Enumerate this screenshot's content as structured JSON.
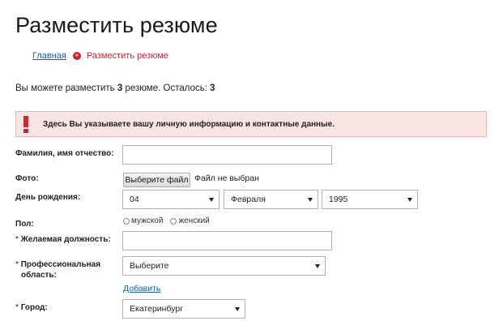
{
  "page": {
    "title": "Разместить резюме"
  },
  "breadcrumb": {
    "home": "Главная",
    "separator": "»",
    "current": "Разместить резюме"
  },
  "quota": {
    "prefix": "Вы можете разместить",
    "count": "3",
    "middle": "резюме. Осталось:",
    "remaining": "3"
  },
  "alert": {
    "icon": "exclamation-icon",
    "text": "Здесь Вы указываете вашу личную информацию и контактные данные."
  },
  "form": {
    "full_name": {
      "label": "Фамилия, имя отчество:",
      "value": ""
    },
    "photo": {
      "label": "Фото:",
      "button": "Выберите файл",
      "status": "Файл не выбран"
    },
    "birthday": {
      "label": "День рождения:",
      "day": "04",
      "month": "Февраля",
      "year": "1995"
    },
    "gender": {
      "label": "Пол:",
      "options": [
        "мужской",
        "женский"
      ]
    },
    "position": {
      "required_mark": "*",
      "label": "Желаемая должность:",
      "value": ""
    },
    "field": {
      "required_mark": "*",
      "label_line1": "Профессиональная",
      "label_line2": "область:",
      "selected": "Выберите",
      "add_link": "Добавить"
    },
    "city": {
      "required_mark": "*",
      "label": "Город:",
      "selected": "Екатеринбург"
    }
  },
  "colors": {
    "accent_red": "#c8262e",
    "link_blue": "#1a5fa8",
    "alert_bg": "#fbe4e4"
  }
}
